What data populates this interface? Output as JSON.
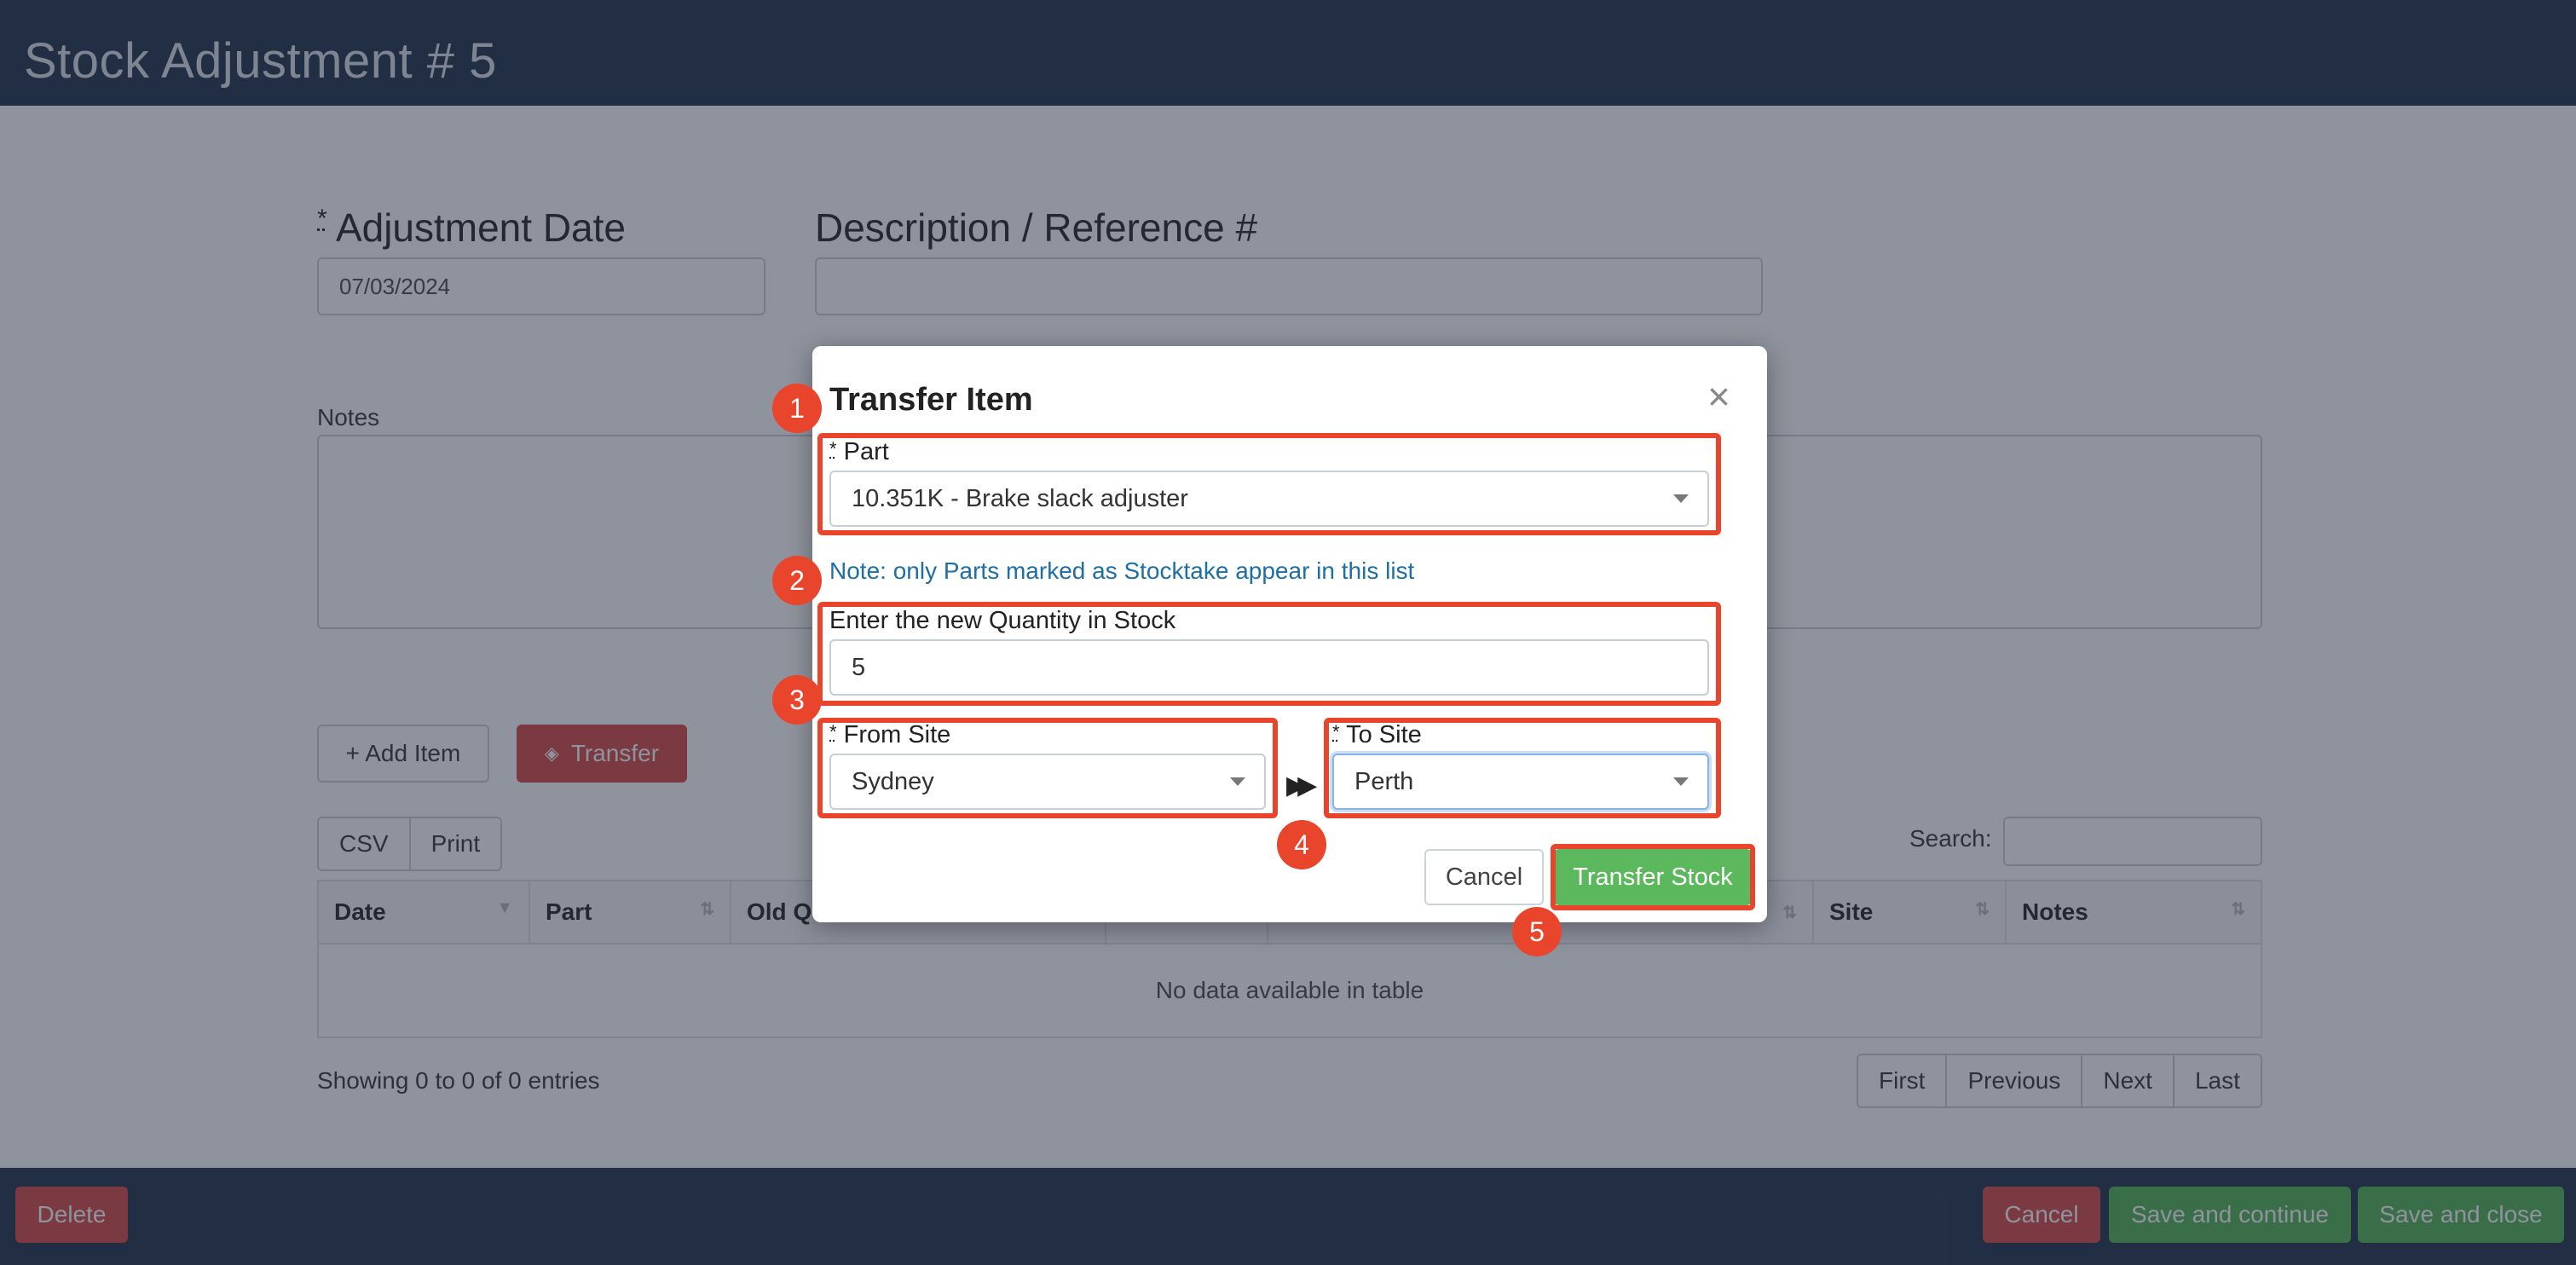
{
  "page": {
    "title": "Stock Adjustment # 5",
    "adjustment_date_label": "Adjustment Date",
    "adjustment_date_value": "07/03/2024",
    "description_label": "Description / Reference #",
    "description_value": "",
    "notes_label": "Notes",
    "required_mark": "*",
    "add_item_label": "+ Add Item",
    "transfer_label": "Transfer",
    "csv_label": "CSV",
    "print_label": "Print",
    "search_label": "Search:",
    "search_value": "",
    "table": {
      "columns": [
        "Date",
        "Part",
        "Old Q",
        "",
        "",
        "Site",
        "Notes"
      ],
      "empty_message": "No data available in table"
    },
    "entries_info": "Showing 0 to 0 of 0 entries",
    "pagination": [
      "First",
      "Previous",
      "Next",
      "Last"
    ],
    "footer": {
      "delete_label": "Delete",
      "cancel_label": "Cancel",
      "save_continue_label": "Save and continue",
      "save_close_label": "Save and close"
    }
  },
  "modal": {
    "title": "Transfer Item",
    "close_glyph": "×",
    "required_mark": "*",
    "part_label": "Part",
    "part_value": "10.351K - Brake slack adjuster",
    "note": "Note: only Parts marked as Stocktake appear in this list",
    "quantity_label": "Enter the new Quantity in Stock",
    "quantity_value": "5",
    "from_site_label": "From Site",
    "from_site_value": "Sydney",
    "to_site_label": "To Site",
    "to_site_value": "Perth",
    "transfer_arrows": "▶▶",
    "cancel_label": "Cancel",
    "transfer_stock_label": "Transfer Stock"
  },
  "annotations": [
    "1",
    "2",
    "3",
    "4",
    "5"
  ],
  "colors": {
    "header_bg": "#2f3e54",
    "highlight": "#e8452c",
    "success": "#5cb85c",
    "danger": "#d9534f",
    "note_text": "#1d6fa5"
  }
}
